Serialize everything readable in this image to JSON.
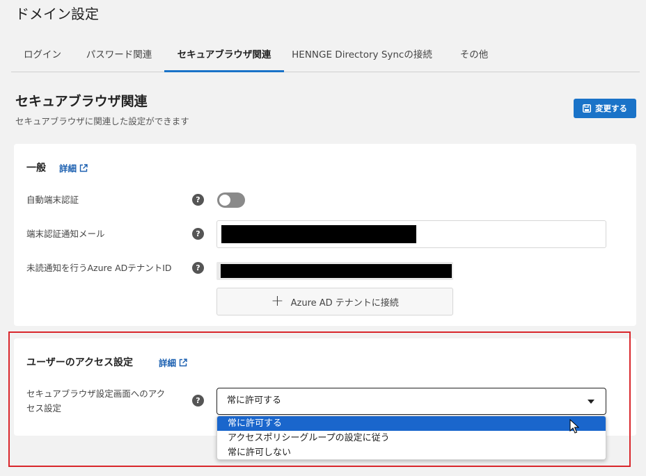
{
  "page": {
    "title": "ドメイン設定"
  },
  "tabs": [
    {
      "label": "ログイン",
      "active": false
    },
    {
      "label": "パスワード関連",
      "active": false
    },
    {
      "label": "セキュアブラウザ関連",
      "active": true
    },
    {
      "label": "HENNGE Directory Syncの接続",
      "active": false
    },
    {
      "label": "その他",
      "active": false
    }
  ],
  "section": {
    "title": "セキュアブラウザ関連",
    "description": "セキュアブラウザに関連した設定ができます",
    "save_label": "変更する"
  },
  "general": {
    "heading": "一般",
    "detail_label": "詳細",
    "rows": {
      "auto_auth": {
        "label": "自動端末認証",
        "toggle_on": false
      },
      "notify_mail": {
        "label": "端末認証通知メール"
      },
      "tenant_id": {
        "label": "未読通知を行うAzure ADテナントID"
      }
    },
    "connect_label": "Azure AD テナントに接続"
  },
  "access": {
    "heading": "ユーザーのアクセス設定",
    "detail_label": "詳細",
    "label_line1": "セキュアブラウザ設定画面へのアク",
    "label_line2": "セス設定",
    "selected_value": "常に許可する",
    "options": [
      "常に許可する",
      "アクセスポリシーグループの設定に従う",
      "常に許可しない"
    ]
  },
  "colors": {
    "accent": "#1a73c8",
    "highlight": "#d9262b"
  },
  "icons": {
    "help": "question-circle-icon",
    "external": "external-link-icon",
    "save": "save-icon"
  }
}
